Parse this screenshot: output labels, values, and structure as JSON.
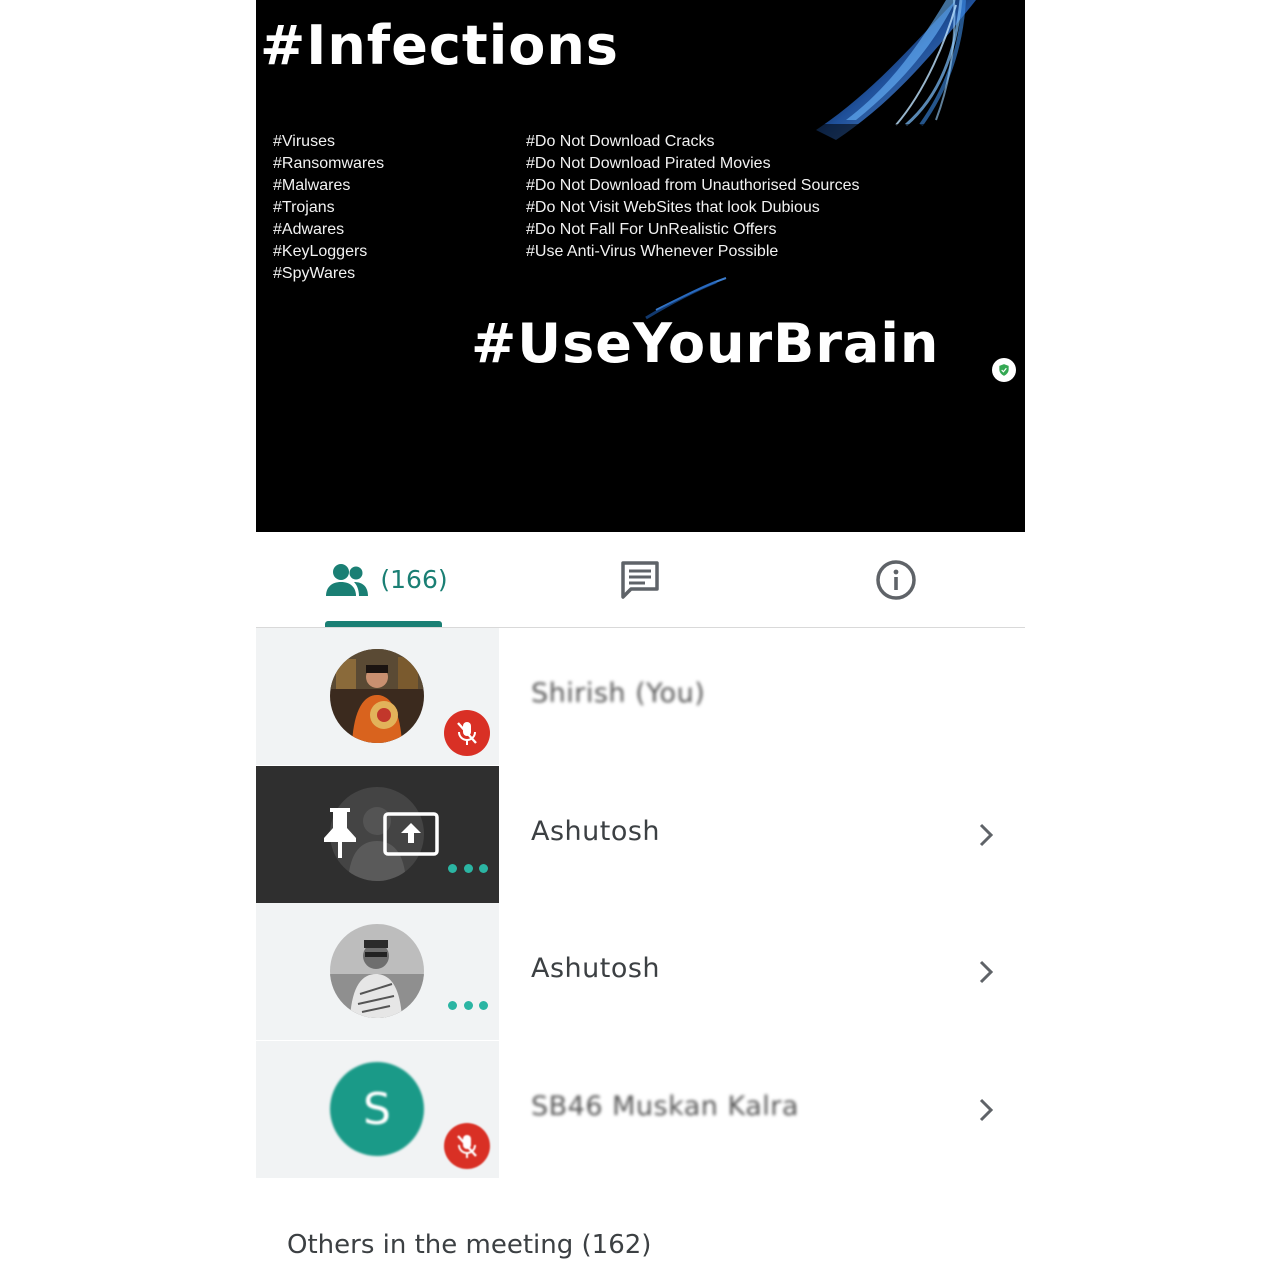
{
  "slide": {
    "title": "#Infections",
    "left_items": [
      "#Viruses",
      "#Ransomwares",
      "#Malwares",
      "#Trojans",
      "#Adwares",
      "#KeyLoggers",
      "#SpyWares"
    ],
    "right_items": [
      "#Do Not Download Cracks",
      "#Do Not Download Pirated Movies",
      "#Do Not Download from Unauthorised Sources",
      "#Do Not Visit WebSites that look Dubious",
      "#Do Not Fall For UnRealistic Offers",
      "#Use Anti-Virus Whenever Possible"
    ],
    "footer": "#UseYourBrain"
  },
  "tabs": {
    "people_count": "(166)",
    "active": "people",
    "icons": [
      "people-icon",
      "chat-icon",
      "info-icon"
    ]
  },
  "participants": [
    {
      "name": "Shirish (You)",
      "muted": true,
      "avatar": "photo"
    },
    {
      "name": "Ashutosh",
      "pinned": true,
      "presenting": true,
      "avatar": "photo"
    },
    {
      "name": "Ashutosh",
      "avatar": "photo"
    },
    {
      "name": "SB46 Muskan Kalra",
      "muted": true,
      "avatar_letter": "S"
    }
  ],
  "others": {
    "label": "Others in the meeting (162)"
  },
  "colors": {
    "accent": "#1a7f74",
    "mute_red": "#d93025",
    "dots": "#2bb5a3"
  }
}
